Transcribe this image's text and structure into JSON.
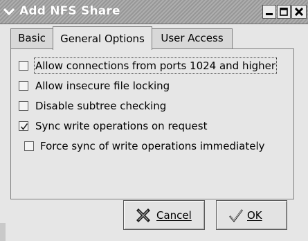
{
  "window": {
    "title": "Add NFS Share",
    "icons": {
      "menu": "chevron-down-icon",
      "minimize": "minimize-icon",
      "maximize": "maximize-icon",
      "close": "close-icon"
    }
  },
  "tabs": [
    {
      "label": "Basic",
      "active": false
    },
    {
      "label": "General Options",
      "active": true
    },
    {
      "label": "User Access",
      "active": false
    }
  ],
  "options": [
    {
      "label": "Allow connections from ports 1024 and higher",
      "checked": false,
      "focused": true
    },
    {
      "label": "Allow insecure file locking",
      "checked": false
    },
    {
      "label": "Disable subtree checking",
      "checked": false
    },
    {
      "label": "Sync write operations on request",
      "checked": true
    },
    {
      "label": "Force sync of write operations immediately",
      "checked": false
    }
  ],
  "buttons": {
    "cancel": {
      "label": "Cancel",
      "icon": "cancel-x-icon"
    },
    "ok": {
      "label": "OK",
      "icon": "checkmark-icon"
    }
  }
}
